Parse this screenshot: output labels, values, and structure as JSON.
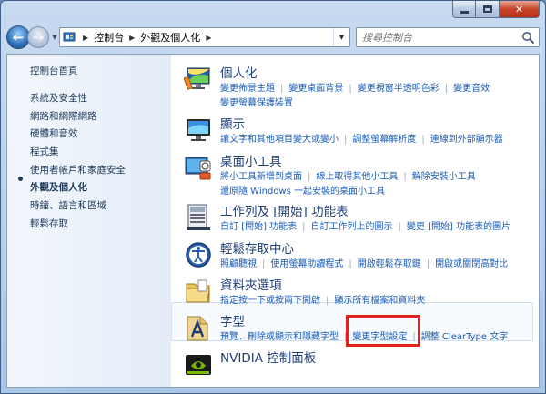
{
  "window": {
    "close_glyph": "✕"
  },
  "navbar": {
    "breadcrumb": [
      "控制台",
      "外觀及個人化"
    ],
    "search_placeholder": "搜尋控制台"
  },
  "sidebar": {
    "home": "控制台首頁",
    "items": [
      {
        "label": "系統及安全性"
      },
      {
        "label": "網路和網際網路"
      },
      {
        "label": "硬體和音效"
      },
      {
        "label": "程式集"
      },
      {
        "label": "使用者帳戶和家庭安全"
      },
      {
        "label": "外觀及個人化",
        "active": true
      },
      {
        "label": "時鐘、語言和區域"
      },
      {
        "label": "輕鬆存取"
      }
    ]
  },
  "categories": [
    {
      "title": "個人化",
      "icon": "personalization-icon",
      "links": [
        [
          "變更佈景主題",
          "變更桌面背景",
          "變更視窗半透明色彩",
          "變更音效"
        ],
        [
          "變更螢幕保護裝置"
        ]
      ]
    },
    {
      "title": "顯示",
      "icon": "display-icon",
      "links": [
        [
          "讓文字和其他項目變大或變小",
          "調整螢幕解析度",
          "連線到外部顯示器"
        ]
      ]
    },
    {
      "title": "桌面小工具",
      "icon": "gadgets-icon",
      "links": [
        [
          "將小工具新增到桌面",
          "線上取得其他小工具",
          "解除安裝小工具"
        ],
        [
          "還原隨 Windows 一起安裝的桌面小工具"
        ]
      ]
    },
    {
      "title": "工作列及 [開始] 功能表",
      "icon": "taskbar-icon",
      "links": [
        [
          "自訂 [開始] 功能表",
          "自訂工作列上的圖示",
          "變更 [開始] 功能表的圖片"
        ]
      ]
    },
    {
      "title": "輕鬆存取中心",
      "icon": "ease-of-access-icon",
      "links": [
        [
          "照顧聽視",
          "使用螢幕助讀程式",
          "開啟輕鬆存取鍵",
          "開啟或關閉高對比"
        ]
      ]
    },
    {
      "title": "資料夾選項",
      "icon": "folder-options-icon",
      "links": [
        [
          "指定按一下或按兩下開啟",
          "顯示所有檔案和資料夾"
        ]
      ]
    },
    {
      "title": "字型",
      "icon": "fonts-icon",
      "links": [
        [
          "預覽、刪除或顯示和隱藏字型",
          "變更字型設定",
          "調整 ClearType 文字"
        ]
      ]
    },
    {
      "title": "NVIDIA 控制面板",
      "icon": "nvidia-icon",
      "links": []
    }
  ]
}
